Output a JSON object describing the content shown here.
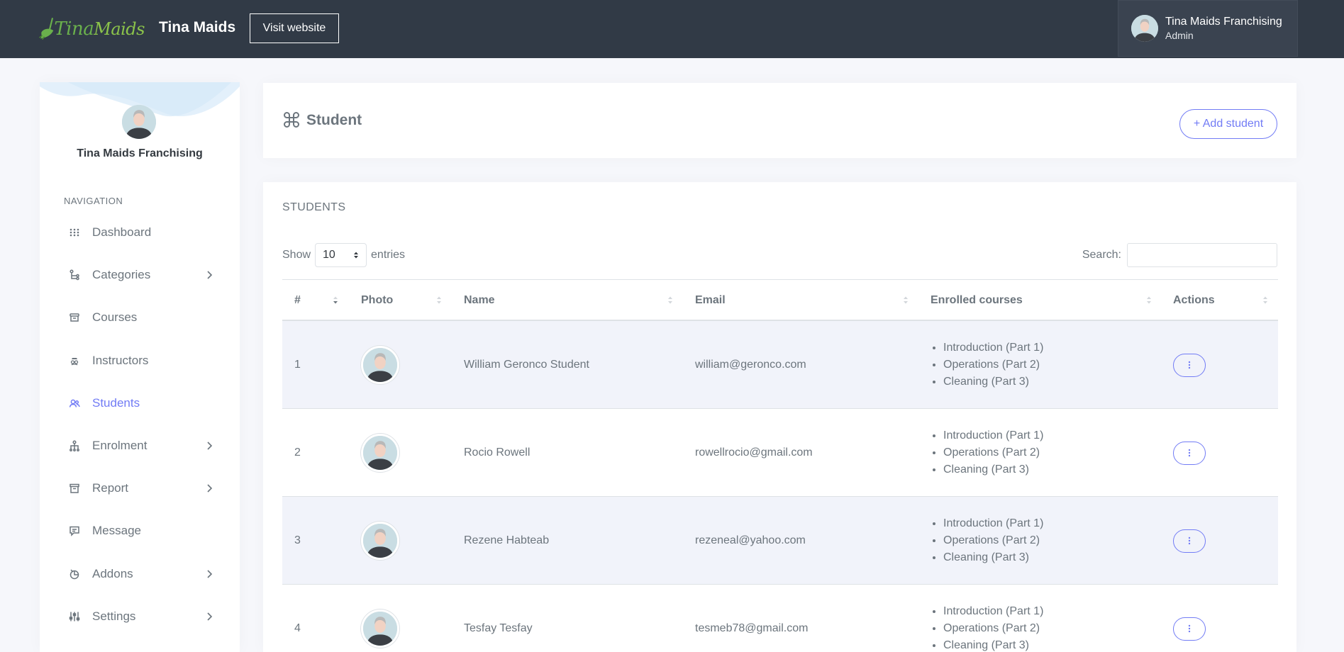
{
  "header": {
    "logo_text_1": "Tina",
    "logo_text_2": "Maids",
    "brand": "Tina Maids",
    "visit_label": "Visit website",
    "user_name": "Tina Maids Franchising",
    "user_role": "Admin"
  },
  "sidebar": {
    "profile_name": "Tina Maids Franchising",
    "nav_title": "NAVIGATION",
    "items": [
      {
        "label": "Dashboard",
        "icon": "dashboard-icon",
        "has_sub": false,
        "active": false
      },
      {
        "label": "Categories",
        "icon": "categories-icon",
        "has_sub": true,
        "active": false
      },
      {
        "label": "Courses",
        "icon": "courses-icon",
        "has_sub": false,
        "active": false
      },
      {
        "label": "Instructors",
        "icon": "instructors-icon",
        "has_sub": false,
        "active": false
      },
      {
        "label": "Students",
        "icon": "students-icon",
        "has_sub": false,
        "active": true
      },
      {
        "label": "Enrolment",
        "icon": "enrolment-icon",
        "has_sub": true,
        "active": false
      },
      {
        "label": "Report",
        "icon": "report-icon",
        "has_sub": true,
        "active": false
      },
      {
        "label": "Message",
        "icon": "message-icon",
        "has_sub": false,
        "active": false
      },
      {
        "label": "Addons",
        "icon": "addons-icon",
        "has_sub": true,
        "active": false
      },
      {
        "label": "Settings",
        "icon": "settings-icon",
        "has_sub": true,
        "active": false
      }
    ]
  },
  "page": {
    "title": "Student",
    "add_label": "+ Add student"
  },
  "students_card": {
    "heading": "STUDENTS",
    "show_label": "Show",
    "entries_value": "10",
    "entries_label": "entries",
    "search_label": "Search:",
    "search_value": ""
  },
  "table": {
    "columns": [
      "#",
      "Photo",
      "Name",
      "Email",
      "Enrolled courses",
      "Actions"
    ],
    "rows": [
      {
        "num": "1",
        "name": "William Geronco Student",
        "email": "william@geronco.com",
        "courses": [
          "Introduction (Part 1)",
          "Operations (Part 2)",
          "Cleaning (Part 3)"
        ]
      },
      {
        "num": "2",
        "name": "Rocio Rowell",
        "email": "rowellrocio@gmail.com",
        "courses": [
          "Introduction (Part 1)",
          "Operations (Part 2)",
          "Cleaning (Part 3)"
        ]
      },
      {
        "num": "3",
        "name": "Rezene Habteab",
        "email": "rezeneal@yahoo.com",
        "courses": [
          "Introduction (Part 1)",
          "Operations (Part 2)",
          "Cleaning (Part 3)"
        ]
      },
      {
        "num": "4",
        "name": "Tesfay Tesfay",
        "email": "tesmeb78@gmail.com",
        "courses": [
          "Introduction (Part 1)",
          "Operations (Part 2)",
          "Cleaning (Part 3)"
        ]
      }
    ]
  },
  "colors": {
    "topbar": "#313a46",
    "accent": "#727cf5",
    "muted": "#6c757d",
    "logo_green": "#6ab04c"
  }
}
